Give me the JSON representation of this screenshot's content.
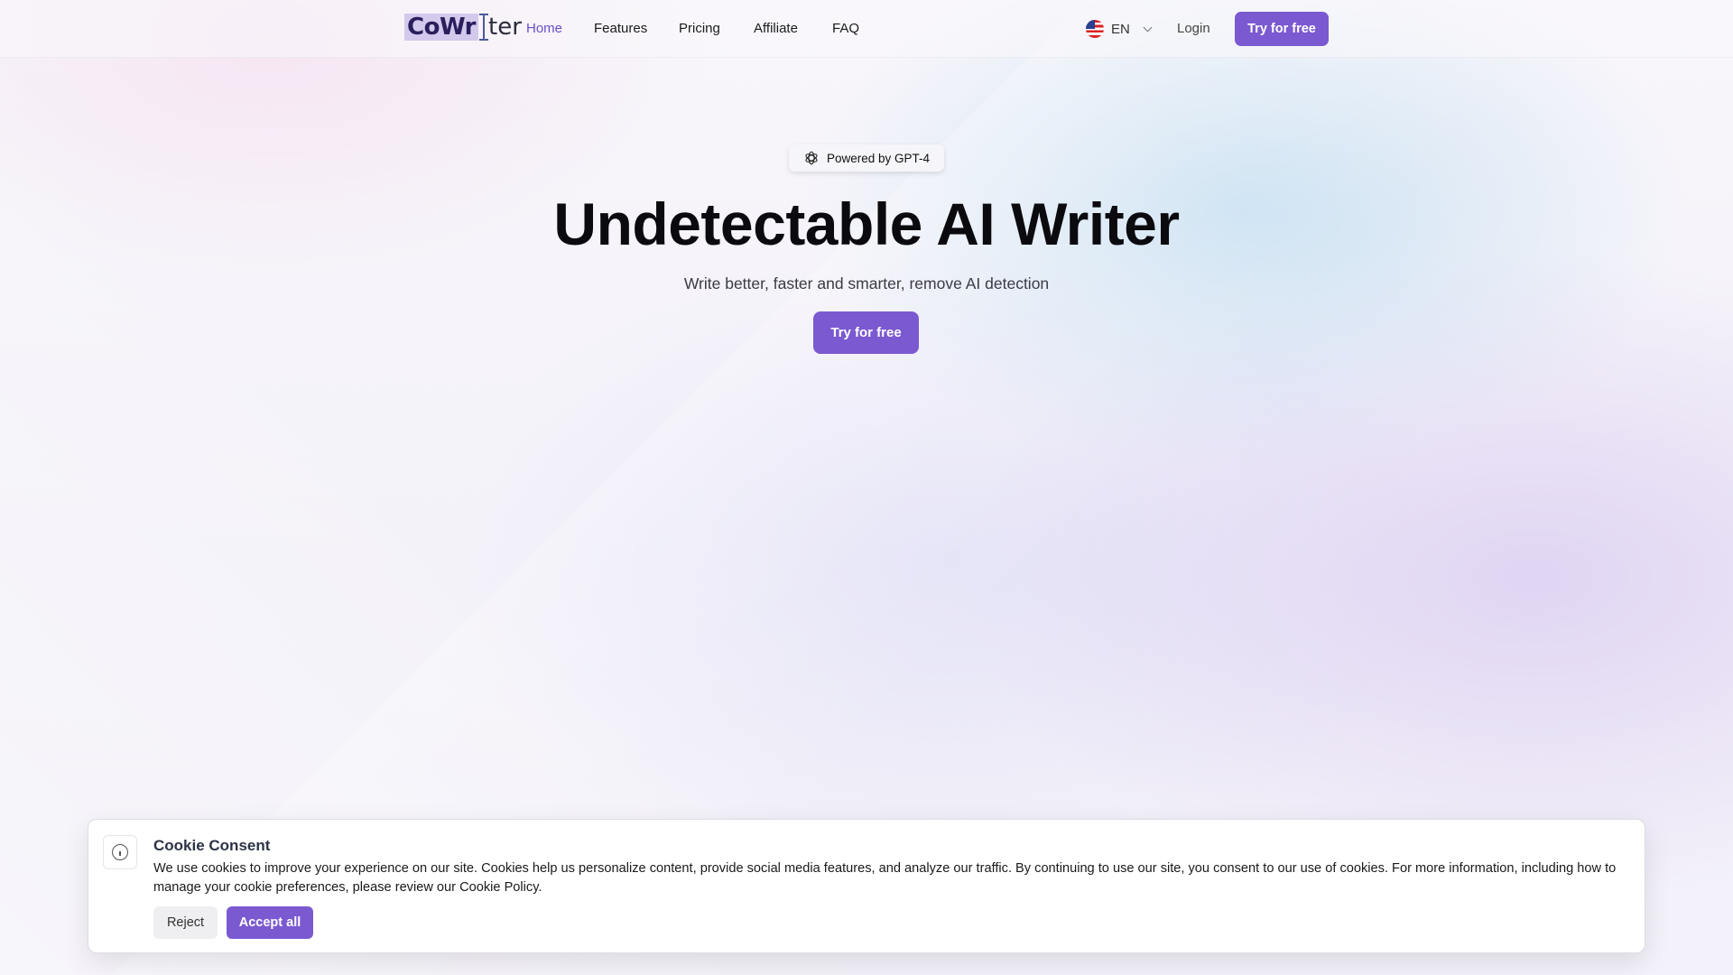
{
  "brand": {
    "logo_highlight": "CoWr",
    "logo_rest": "ter",
    "accent_color": "#7b59d1"
  },
  "nav": {
    "links": [
      {
        "label": "Home",
        "active": true
      },
      {
        "label": "Features",
        "active": false
      },
      {
        "label": "Pricing",
        "active": false
      },
      {
        "label": "Affiliate",
        "active": false
      },
      {
        "label": "FAQ",
        "active": false
      }
    ],
    "language": {
      "code": "EN",
      "flag_icon": "us-flag-icon"
    },
    "login_label": "Login",
    "cta_label": "Try for free"
  },
  "hero": {
    "badge": "Powered by GPT-4",
    "badge_icon": "openai-logo-icon",
    "title": "Undetectable AI Writer",
    "subtitle": "Write better, faster and smarter, remove AI detection",
    "cta_label": "Try for free"
  },
  "cookie_banner": {
    "icon": "info-icon",
    "title": "Cookie Consent",
    "text": "We use cookies to improve your experience on our site. Cookies help us personalize content, provide social media features, and analyze our traffic. By continuing to use our site, you consent to our use of cookies. For more information, including how to manage your cookie preferences, please review our Cookie Policy.",
    "reject_label": "Reject",
    "accept_label": "Accept all"
  }
}
